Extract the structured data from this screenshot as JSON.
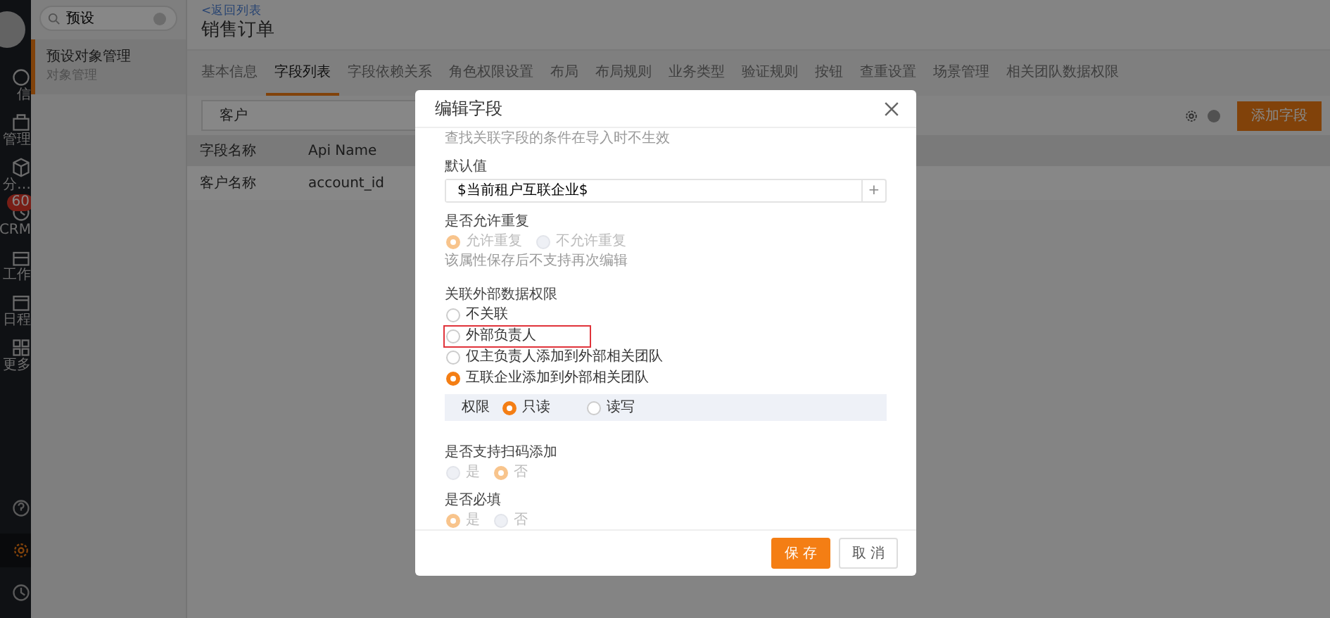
{
  "nav": {
    "items": [
      {
        "label": "信"
      },
      {
        "label": "管理"
      },
      {
        "label": "分…"
      },
      {
        "label": "CRM",
        "badge": "60"
      },
      {
        "label": "工作"
      },
      {
        "label": "日程"
      },
      {
        "label": "更多"
      }
    ],
    "bottom": [
      {
        "selected": false
      },
      {
        "selected": true
      },
      {
        "selected": false
      }
    ]
  },
  "sidebar": {
    "search": "预设",
    "items": [
      {
        "title": "预设对象管理",
        "subtitle": "对象管理",
        "selected": true
      }
    ]
  },
  "header": {
    "back": "<返回列表",
    "title": "销售订单"
  },
  "tabs": [
    {
      "label": "基本信息",
      "selected": false
    },
    {
      "label": "字段列表",
      "selected": true
    },
    {
      "label": "字段依赖关系",
      "selected": false
    },
    {
      "label": "角色权限设置",
      "selected": false
    },
    {
      "label": "布局",
      "selected": false
    },
    {
      "label": "布局规则",
      "selected": false
    },
    {
      "label": "业务类型",
      "selected": false
    },
    {
      "label": "验证规则",
      "selected": false
    },
    {
      "label": "按钮",
      "selected": false
    },
    {
      "label": "查重设置",
      "selected": false
    },
    {
      "label": "场景管理",
      "selected": false
    },
    {
      "label": "相关团队数据权限",
      "selected": false
    }
  ],
  "toolbar": {
    "filter": "客户",
    "add_button": "添加字段"
  },
  "table": {
    "columns": [
      "字段名称",
      "Api Name"
    ],
    "rows": [
      [
        "客户名称",
        "account_id"
      ]
    ]
  },
  "modal": {
    "title": "编辑字段",
    "hint": "查找关联字段的条件在导入时不生效",
    "default_value": {
      "label": "默认值",
      "value": "$当前租户互联企业$",
      "addon": "+"
    },
    "groups": [
      {
        "label": "是否允许重复",
        "disabled": true,
        "inline": true,
        "options": [
          {
            "label": "允许重复",
            "selected": true,
            "highlighted": false
          },
          {
            "label": "不允许重复",
            "selected": false,
            "highlighted": false
          }
        ],
        "note": "该属性保存后不支持再次编辑"
      },
      {
        "label": "关联外部数据权限",
        "disabled": false,
        "inline": false,
        "options": [
          {
            "label": "不关联",
            "selected": false,
            "highlighted": false
          },
          {
            "label": "外部负责人",
            "selected": false,
            "highlighted": true
          },
          {
            "label": "仅主负责人添加到外部相关团队",
            "selected": false,
            "highlighted": false
          },
          {
            "label": "互联企业添加到外部相关团队",
            "selected": true,
            "highlighted": false
          }
        ],
        "panel": {
          "label": "权限",
          "options": [
            {
              "label": "只读",
              "selected": true
            },
            {
              "label": "读写",
              "selected": false
            }
          ]
        }
      },
      {
        "label": "是否支持扫码添加",
        "disabled": true,
        "inline": true,
        "options": [
          {
            "label": "是",
            "selected": false,
            "highlighted": false
          },
          {
            "label": "否",
            "selected": true,
            "highlighted": false
          }
        ]
      },
      {
        "label": "是否必填",
        "disabled": true,
        "inline": true,
        "options": [
          {
            "label": "是",
            "selected": true,
            "highlighted": false
          },
          {
            "label": "否",
            "selected": false,
            "highlighted": false
          }
        ]
      }
    ],
    "buttons": [
      {
        "label": "保 存",
        "kind": "primary"
      },
      {
        "label": "取 消",
        "kind": "secondary"
      }
    ]
  }
}
